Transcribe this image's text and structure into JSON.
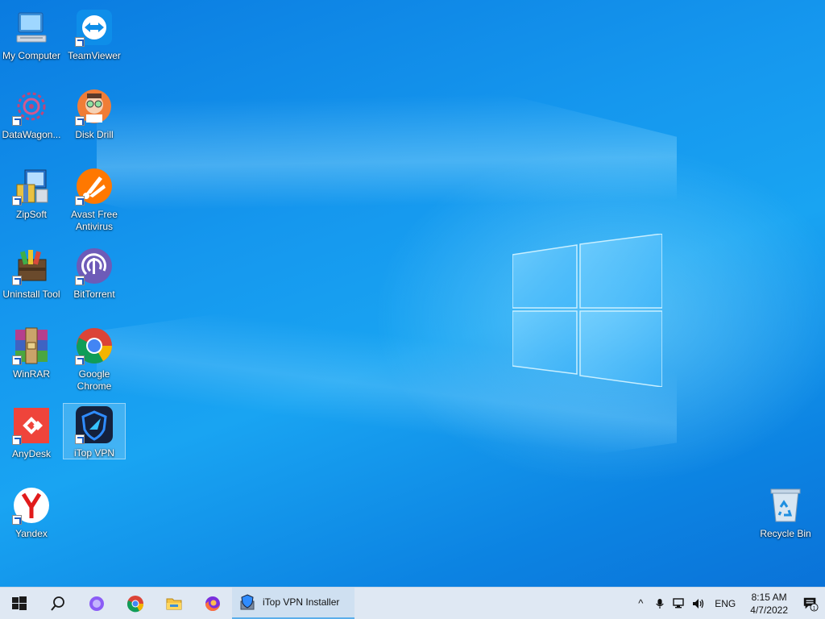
{
  "desktop": {
    "icons": [
      {
        "label": "My Computer",
        "icon": "computer-icon"
      },
      {
        "label": "TeamViewer",
        "icon": "teamviewer-icon"
      },
      {
        "label": "DataWagon...",
        "icon": "datawagon-icon"
      },
      {
        "label": "Disk Drill",
        "icon": "disk-drill-icon"
      },
      {
        "label": "ZipSoft",
        "icon": "zipsoft-icon"
      },
      {
        "label": "Avast Free Antivirus",
        "icon": "avast-icon"
      },
      {
        "label": "Uninstall Tool",
        "icon": "uninstall-tool-icon"
      },
      {
        "label": "BitTorrent",
        "icon": "bittorrent-icon"
      },
      {
        "label": "WinRAR",
        "icon": "winrar-icon"
      },
      {
        "label": "Google Chrome",
        "icon": "chrome-icon"
      },
      {
        "label": "AnyDesk",
        "icon": "anydesk-icon"
      },
      {
        "label": "iTop VPN",
        "icon": "itop-vpn-icon",
        "selected": true
      },
      {
        "label": "Yandex",
        "icon": "yandex-icon"
      },
      {
        "label": "Recycle Bin",
        "icon": "recycle-bin-icon"
      }
    ]
  },
  "taskbar": {
    "pinned": [
      "start-icon",
      "search-icon",
      "cortana-icon",
      "chrome-icon",
      "file-explorer-icon",
      "firefox-icon"
    ],
    "running_app": {
      "label": "iTop VPN Installer",
      "icon": "itop-vpn-installer-icon"
    },
    "tray": {
      "language": "ENG",
      "time": "8:15 AM",
      "date": "4/7/2022",
      "notification_count": "1"
    }
  },
  "colors": {
    "accent": "#0a7be0",
    "taskbar_bg": "#dfe8f3",
    "active_app_underline": "#5aaeea"
  }
}
